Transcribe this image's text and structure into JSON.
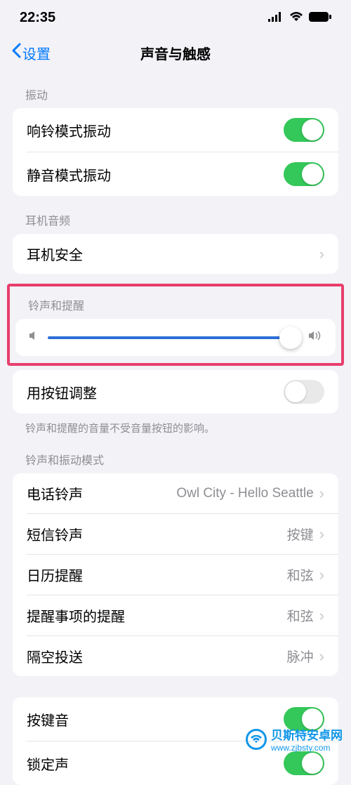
{
  "statusbar": {
    "time": "22:35"
  },
  "nav": {
    "back": "设置",
    "title": "声音与触感"
  },
  "vibrate": {
    "header": "振动",
    "ring": "响铃模式振动",
    "silent": "静音模式振动"
  },
  "headphone": {
    "header": "耳机音频",
    "safety": "耳机安全"
  },
  "ringer": {
    "header": "铃声和提醒",
    "button_adjust": "用按钮调整",
    "note": "铃声和提醒的音量不受音量按钮的影响。"
  },
  "sounds": {
    "header": "铃声和振动模式",
    "ringtone": {
      "label": "电话铃声",
      "value": "Owl City - Hello Seattle"
    },
    "text": {
      "label": "短信铃声",
      "value": "按键"
    },
    "calendar": {
      "label": "日历提醒",
      "value": "和弦"
    },
    "reminder": {
      "label": "提醒事项的提醒",
      "value": "和弦"
    },
    "airdrop": {
      "label": "隔空投送",
      "value": "脉冲"
    }
  },
  "system": {
    "keyboard": "按键音",
    "lock": "锁定声"
  },
  "watermark": {
    "name": "贝斯特安卓网",
    "url": "www.zjbsty.com"
  }
}
